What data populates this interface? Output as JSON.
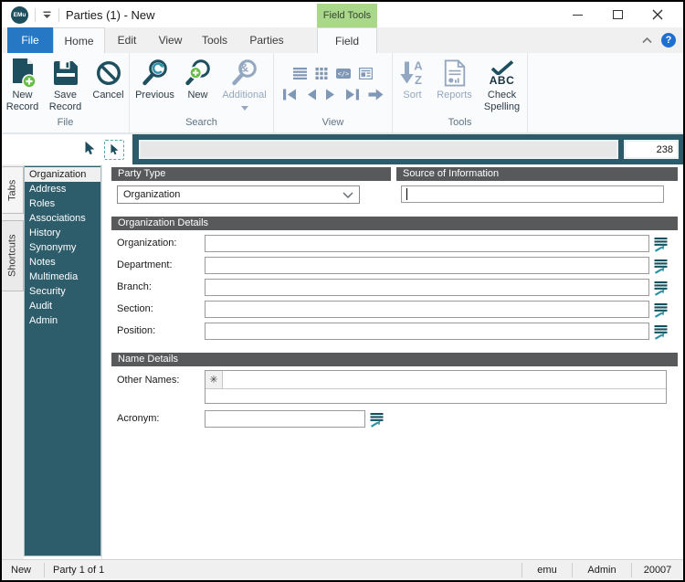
{
  "window": {
    "icon_text": "EMu",
    "title": "Parties (1) - New",
    "field_tools_label": "Field Tools",
    "help_glyph": "?"
  },
  "tabs": {
    "file": "File",
    "home": "Home",
    "edit": "Edit",
    "view": "View",
    "tools": "Tools",
    "parties": "Parties",
    "field": "Field"
  },
  "ribbon": {
    "file_group": {
      "label": "File",
      "new_record": "New Record",
      "save_record": "Save Record",
      "cancel": "Cancel"
    },
    "search_group": {
      "label": "Search",
      "previous": "Previous",
      "new": "New",
      "additional": "Additional",
      "ampersand_glyph": "&"
    },
    "view_group": {
      "label": "View",
      "code_glyph": "</>"
    },
    "tools_group": {
      "label": "Tools",
      "sort": "Sort",
      "reports": "Reports",
      "check_spelling": "Check Spelling",
      "abc_glyph": "ABC",
      "sort_a": "A",
      "sort_z": "Z"
    }
  },
  "record_bar": {
    "summary_value": "",
    "count": "238"
  },
  "sidebar": {
    "strip_tabs": [
      "Tabs",
      "Shortcuts"
    ],
    "items": [
      "Organization",
      "Address",
      "Roles",
      "Associations",
      "History",
      "Synonymy",
      "Notes",
      "Multimedia",
      "Security",
      "Audit",
      "Admin"
    ],
    "selected_item": "Organization"
  },
  "form": {
    "party_type_header": "Party Type",
    "party_type_value": "Organization",
    "source_header": "Source of Information",
    "source_value": "",
    "org_details_header": "Organization Details",
    "org_fields": [
      {
        "label": "Organization:",
        "value": ""
      },
      {
        "label": "Department:",
        "value": ""
      },
      {
        "label": "Branch:",
        "value": ""
      },
      {
        "label": "Section:",
        "value": ""
      },
      {
        "label": "Position:",
        "value": ""
      }
    ],
    "name_details_header": "Name Details",
    "other_names_label": "Other Names:",
    "other_names_value": "",
    "grid_add_glyph": "✳",
    "acronym_label": "Acronym:",
    "acronym_value": ""
  },
  "status_bar": {
    "mode": "New",
    "position": "Party 1 of 1",
    "database": "emu",
    "user": "Admin",
    "port": "20007"
  },
  "colors": {
    "teal_dark": "#1d4f5e",
    "teal_panel": "#2d5c6b",
    "green_accent": "#66bd45",
    "disabled_blue": "#93a7c0",
    "view_icon_blue": "#8097b5",
    "header_gray": "#58595b",
    "file_tab_blue": "#2678c4",
    "field_tools_green": "#a9d88b",
    "help_blue": "#1f6fd0"
  }
}
